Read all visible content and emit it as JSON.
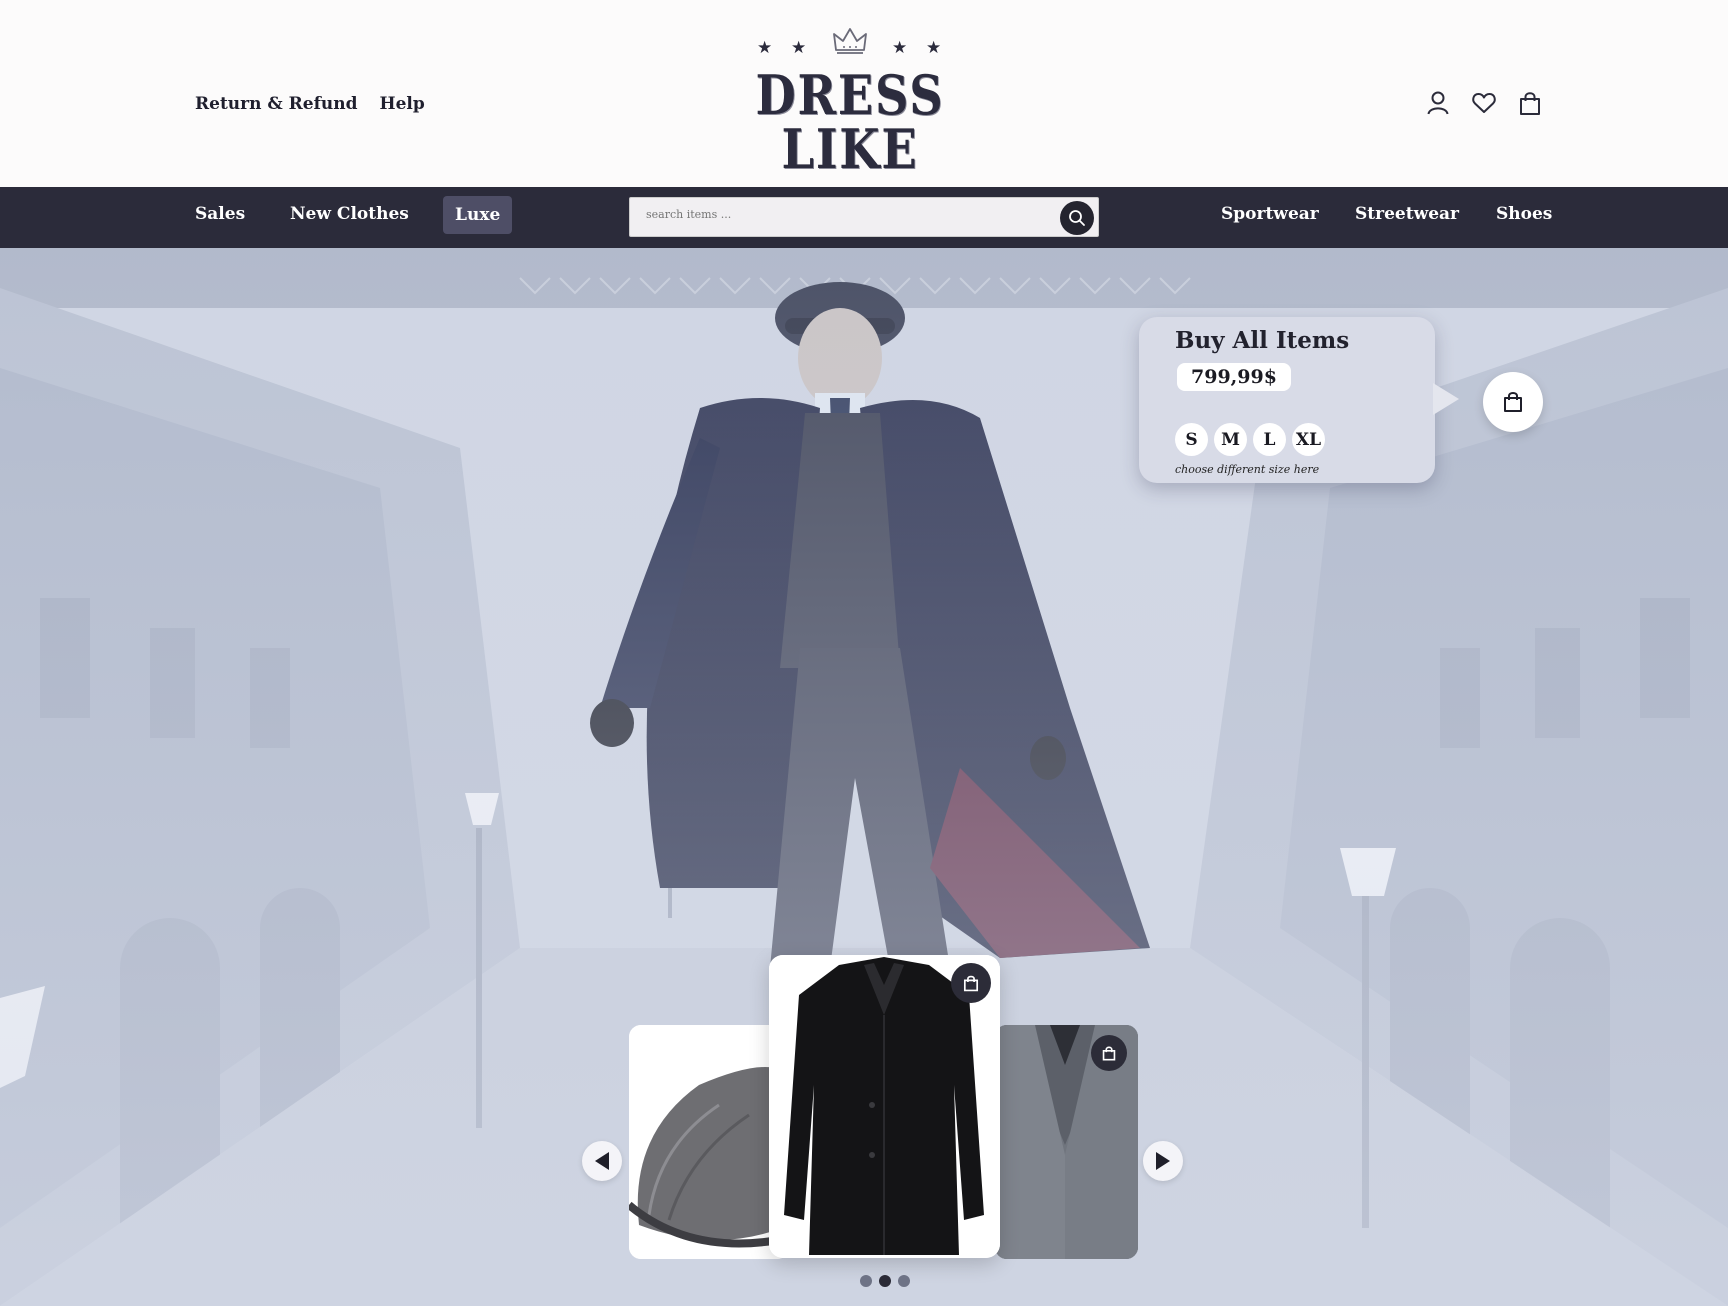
{
  "header": {
    "links": [
      "Return & Refund",
      "Help"
    ],
    "logo_text": "DRESS LIKE",
    "icons": [
      "user-icon",
      "heart-icon",
      "shopping-bag-icon"
    ]
  },
  "nav": {
    "left_items": [
      "Sales",
      "New Clothes",
      "Luxe"
    ],
    "active_item": "Luxe",
    "search_placeholder": "search items ...",
    "right_items": [
      "Sportwear",
      "Streetwear",
      "Shoes"
    ]
  },
  "buy_panel": {
    "title": "Buy All Items",
    "price": "799,99$",
    "sizes": [
      "S",
      "M",
      "L",
      "XL"
    ],
    "size_note": "choose different size here"
  },
  "carousel": {
    "items": [
      "flat-cap",
      "black-coat",
      "grey-suit-vest"
    ],
    "active_index": 1,
    "dot_count": 3
  },
  "colors": {
    "nav_bg": "#2b2b3a",
    "active_nav_bg": "#4e4e66",
    "panel_bg": "#d8dbe7",
    "hero_tint": "#cdd4e4"
  }
}
